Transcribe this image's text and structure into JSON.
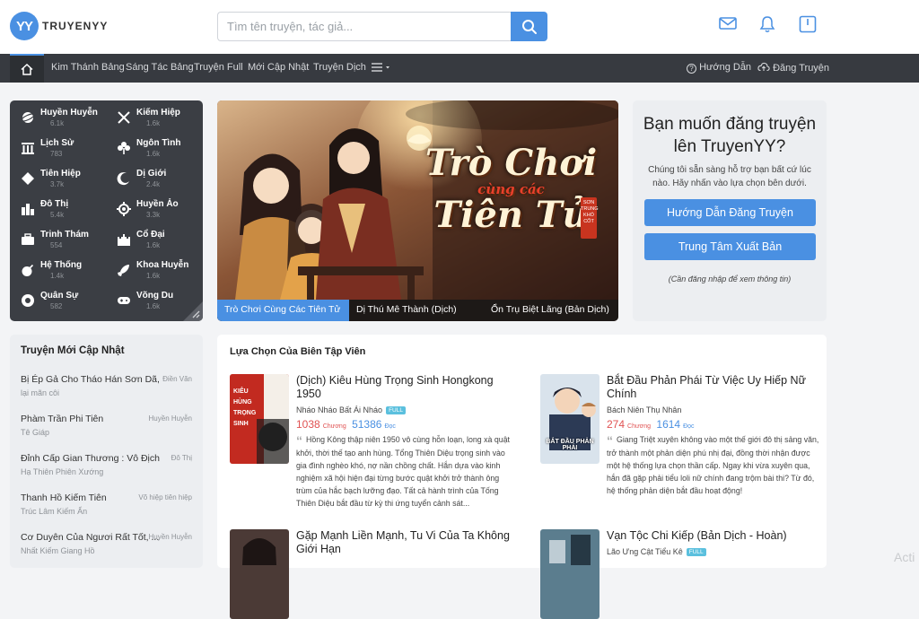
{
  "header": {
    "logo_badge": "YY",
    "logo_text": "TRUYENYY",
    "search_placeholder": "Tìm tên truyện, tác giả...",
    "icons": [
      "mail-icon",
      "bell-icon",
      "book-icon"
    ]
  },
  "nav": {
    "items": [
      "Kim Thánh Bảng",
      "Sáng Tác Bảng",
      "Truyện Full",
      "Mới Cập Nhật",
      "Truyện Dịch"
    ],
    "help": "Hướng Dẫn",
    "upload": "Đăng Truyện"
  },
  "genres": [
    {
      "name": "Huyền Huyễn",
      "count": "6.1k",
      "icon": "planet-icon"
    },
    {
      "name": "Kiếm Hiệp",
      "count": "1.6k",
      "icon": "swords-icon"
    },
    {
      "name": "Lịch Sử",
      "count": "783",
      "icon": "pillars-icon"
    },
    {
      "name": "Ngôn Tình",
      "count": "1.6k",
      "icon": "flower-icon"
    },
    {
      "name": "Tiên Hiệp",
      "count": "3.7k",
      "icon": "diamond-icon"
    },
    {
      "name": "Dị Giới",
      "count": "2.4k",
      "icon": "moon-icon"
    },
    {
      "name": "Đô Thị",
      "count": "5.4k",
      "icon": "city-icon"
    },
    {
      "name": "Huyền Ảo",
      "count": "3.3k",
      "icon": "flask-icon"
    },
    {
      "name": "Trinh Thám",
      "count": "554",
      "icon": "briefcase-icon"
    },
    {
      "name": "Cổ Đại",
      "count": "1.6k",
      "icon": "castle-icon"
    },
    {
      "name": "Hệ Thống",
      "count": "1.4k",
      "icon": "bomb-icon"
    },
    {
      "name": "Khoa Huyễn",
      "count": "1.6k",
      "icon": "rocket-icon"
    },
    {
      "name": "Quân Sự",
      "count": "582",
      "icon": "shield-icon"
    },
    {
      "name": "Võng Du",
      "count": "1.6k",
      "icon": "gamepad-icon"
    }
  ],
  "banner": {
    "title_line1": "Trò Chơi",
    "title_mid": "cùng các",
    "title_line2": "Tiên Tử",
    "seal": "SƠN TRUNG KHỔ CỐT",
    "tabs": [
      "Trò Chơi Cùng Các Tiên Tử",
      "Dị Thú Mê Thành (Dịch)",
      "Ổn Trụ Biệt Lãng (Bản Dịch)"
    ]
  },
  "promo": {
    "heading": "Bạn muốn đăng truyện lên TruyenYY?",
    "text": "Chúng tôi sẵn sàng hỗ trợ bạn bất cứ lúc nào. Hãy nhấn vào lựa chọn bên dưới.",
    "button1": "Hướng Dẫn Đăng Truyện",
    "button2": "Trung Tâm Xuất Bản",
    "note": "(Cần đăng nhập để xem thông tin)"
  },
  "updates": {
    "title": "Truyện Mới Cập Nhật",
    "items": [
      {
        "title": "Bị Ép Gả Cho Tháo Hán Sơn Dã, ...",
        "genre": "Điền Văn",
        "author": "lại mãn côi"
      },
      {
        "title": "Phàm Trần Phi Tiên",
        "genre": "Huyền Huyễn",
        "author": "Tê Giáp"
      },
      {
        "title": "Đỉnh Cấp Gian Thương : Vô Địch T...",
        "genre": "Đô Thị",
        "author": "Hạ Thiên Phiên Xướng"
      },
      {
        "title": "Thanh Hồ Kiếm Tiên",
        "genre": "Võ hiệp tiên hiệp",
        "author": "Trúc Lâm Kiếm Ẩn"
      },
      {
        "title": "Cơ Duyên Của Ngươi Rất Tốt, ...",
        "genre": "Huyền Huyễn",
        "author": "Nhất Kiếm Giang Hồ"
      }
    ]
  },
  "editor": {
    "title": "Lựa Chọn Của Biên Tập Viên",
    "books": [
      {
        "title": "(Dịch) Kiêu Hùng Trọng Sinh Hongkong 1950",
        "author": "Nháo Nháo Bất Ái Nháo",
        "badge": "FULL",
        "chapters": "1038",
        "chapters_label": "Chương",
        "reads": "51386",
        "reads_label": "Đọc",
        "desc": "Hồng Kông thập niên 1950 vô cùng hỗn loạn, long xà quật khởi, thời thế tạo anh hùng. Tổng Thiên Diệu trọng sinh vào gia đình nghèo khó, nợ nần chồng chất. Hắn dựa vào kinh nghiệm xã hội hiện đại từng bước quật khởi trở thành ông trùm của hắc bạch lưỡng đạo. Tất cả hành trình của Tống Thiên Diệu bắt đầu từ kỳ thi ứng tuyển cảnh sát...",
        "cover_text": "KIÊU HÙNG TRỌNG SINH"
      },
      {
        "title": "Bắt Đầu Phản Phái Từ Việc Uy Hiếp Nữ Chính",
        "author": "Bách Niên Thụ Nhân",
        "badge": "",
        "chapters": "274",
        "chapters_label": "Chương",
        "reads": "1614",
        "reads_label": "Đọc",
        "desc": "Giang Triệt xuyên không vào một thế giới đô thị sảng văn, trở thành một phản diện phú nhị đại, đồng thời nhận được một hệ thống lựa chọn thần cấp. Ngay khi vừa xuyên qua, hắn đã gặp phải tiểu loli nữ chính đang trộm bài thi? Từ đó, hệ thống phản diện bắt đầu hoạt động!",
        "cover_text": "BẮT ĐẦU PHẢN PHÁI"
      },
      {
        "title": "Gặp Mạnh Liền Mạnh, Tu Vi Của Ta Không Giới Hạn",
        "author": "",
        "badge": "",
        "chapters": "",
        "chapters_label": "",
        "reads": "",
        "reads_label": "",
        "desc": "",
        "cover_text": ""
      },
      {
        "title": "Vạn Tộc Chi Kiếp (Bản Dịch - Hoàn)",
        "author": "Lão Ưng Cật Tiểu Kê",
        "badge": "FULL",
        "chapters": "",
        "chapters_label": "",
        "reads": "",
        "reads_label": "",
        "desc": "",
        "cover_text": ""
      }
    ]
  },
  "watermark": "Acti",
  "colors": {
    "accent": "#4a90e2",
    "nav_bg": "#373a40",
    "panel_dark": "#3b3e44",
    "red": "#e05252"
  }
}
